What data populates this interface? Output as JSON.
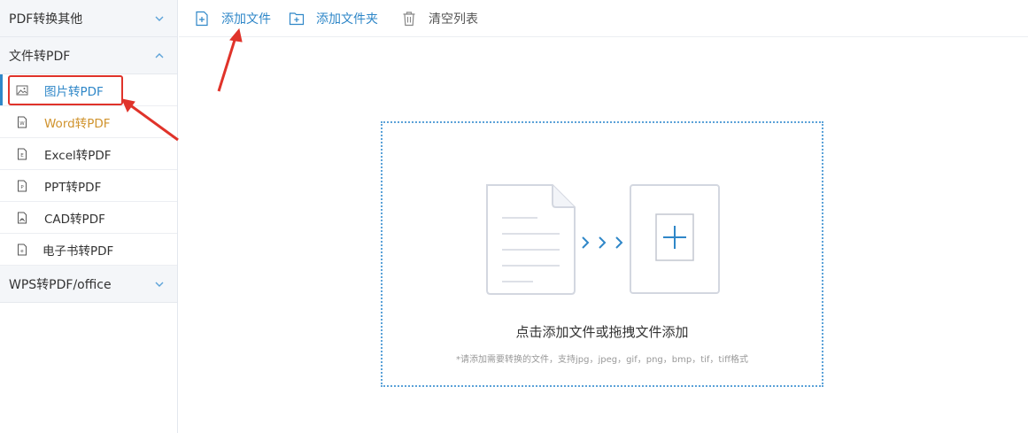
{
  "sidebar": {
    "groups": [
      {
        "label": "PDF转换其他",
        "expanded": false
      },
      {
        "label": "文件转PDF",
        "expanded": true,
        "items": [
          {
            "label": "图片转PDF",
            "icon": "image-file-icon",
            "state": "active"
          },
          {
            "label": "Word转PDF",
            "icon": "word-file-icon",
            "state": "hover"
          },
          {
            "label": "Excel转PDF",
            "icon": "excel-file-icon",
            "state": "normal"
          },
          {
            "label": "PPT转PDF",
            "icon": "ppt-file-icon",
            "state": "normal"
          },
          {
            "label": "CAD转PDF",
            "icon": "cad-file-icon",
            "state": "normal"
          },
          {
            "label": "电子书转PDF",
            "icon": "ebook-file-icon",
            "state": "normal"
          }
        ]
      },
      {
        "label": "WPS转PDF/office",
        "expanded": false
      }
    ]
  },
  "toolbar": {
    "add_file": "添加文件",
    "add_folder": "添加文件夹",
    "clear_list": "清空列表"
  },
  "dropzone": {
    "title": "点击添加文件或拖拽文件添加",
    "hint": "*请添加需要转换的文件，支持jpg，jpeg，gif，png，bmp，tif，tiff格式"
  },
  "colors": {
    "accent": "#2f87c8",
    "hover": "#d0932d",
    "annotation": "#e0332a",
    "dropzone_border": "#5ba2d8"
  }
}
